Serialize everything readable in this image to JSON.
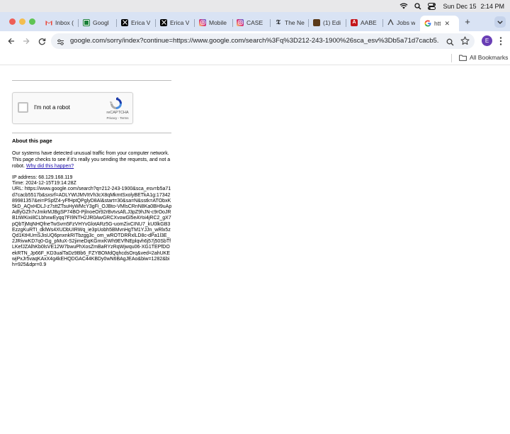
{
  "menubar": {
    "date": "Sun Dec 15",
    "time": "2:14 PM",
    "icons": [
      "wifi-icon",
      "search-icon",
      "control-center-icon"
    ]
  },
  "tabs": [
    {
      "label": "Inbox (",
      "icon": "gmail-icon",
      "color": "#ea4335"
    },
    {
      "label": "Googl",
      "icon": "google-docs-icon",
      "color": "#188038"
    },
    {
      "label": "Erica V",
      "icon": "x-icon",
      "color": "#000000"
    },
    {
      "label": "Erica V",
      "icon": "x-icon",
      "color": "#000000"
    },
    {
      "label": "Mobile",
      "icon": "instagram-icon",
      "color": "#d62976"
    },
    {
      "label": "CASE",
      "icon": "instagram-icon",
      "color": "#d62976"
    },
    {
      "label": "The Ne",
      "icon": "nyt-icon",
      "color": "#000000"
    },
    {
      "label": "(1) Edi",
      "icon": "site-icon",
      "color": "#5b3a1a"
    },
    {
      "label": "AABE",
      "icon": "site-icon",
      "color": "#c4161c"
    },
    {
      "label": "Jobs w",
      "icon": "site-icon",
      "color": "#444444"
    },
    {
      "label": "htt",
      "icon": "google-icon",
      "color": "#4285f4",
      "active": true
    }
  ],
  "toolbar": {
    "url": "google.com/sorry/index?continue=https://www.google.com/search%3Fq%3D212-243-1900%26sca_esv%3Db5a71d7cacb5...",
    "profile_initial": "E"
  },
  "bookmarks": {
    "all_bookmarks": "All Bookmarks"
  },
  "captcha": {
    "label": "I'm not a robot",
    "brand": "reCAPTCHA",
    "links": "Privacy - Terms"
  },
  "about": {
    "title": "About this page",
    "text": "Our systems have detected unusual traffic from your computer network. This page checks to see if it's really you sending the requests, and not a robot. ",
    "link": "Why did this happen?",
    "ip_label": "IP address: 68.129.168.119",
    "time_label": "Time: 2024-12-15T19:14:28Z",
    "url_label": "URL: https://www.google.com/search?q=212-243-1900&sca_esv=b5a71d7cacb5517b&sxsrf=ADLYWIJMVItVh3cX8qMkmtSxolyBETkA1g:1734289981357&ei=PSpfZ4-yFfHptQPglyD8Al&start=30&sa=N&sstk=ATObxK5kD_AQxHDLJ-z7sttZTsuHyWMcY3gFi_OJBto-VMlsCRnN8Ka0BH9uApAdfyGZh7vJmkrMJBgSP74BO-PjlnoeOr92rBvtvsAfLJ3pZ9hJN-c9rOoJRB1tWKixi8CLbhxwEyqq7FI9NTH2JR0AwGRCXvowGl5eAYoi4jRC2_gX7pQbTjMqNHQfneTwSvm5FzVHYvGlotARz5G-uomZixCINU7_kU0lkGB3EzzgKuRTI_dklWs4XUDbUIRWq_ie3pUobh5BMvnHgTM1YJJn_wRlx5zQd1KtHUmSJisUQ6pnxnkRITbzgg3c_om_wROTDRRxlLD8c-dPa1l3E_2JRivwKD7q0-Gg_pMuX-S2jimeDqKGmxKWh9EVfNEplqvh6j57j50SbTfLKefJZAlhKb0lsVE12W7bwuPhXosZmBaRYzRqWjwqu06-XG1TEPfDOekRTN_Jp66F_KD3ualTaDz9Bb6_FZYBOMdQqhcdsOrq&ved=2ahUKEwjPxJr5vaqKAxX4g4kEHQDGAC44KBDy0wN6BAgJEAo&biw=1282&bih=925&dpr=0.9"
  }
}
